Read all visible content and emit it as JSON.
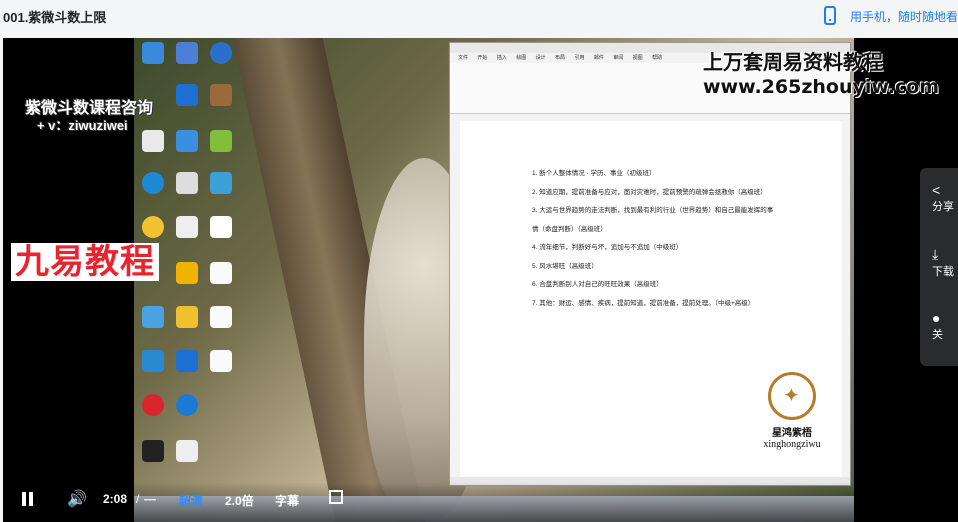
{
  "header": {
    "title": "001.紫微斗数上限",
    "phone_link": "用手机，随时随地看"
  },
  "video": {
    "overlay_course": "紫微斗数课程咨询",
    "overlay_wechat": "+ v：ziwuziwei",
    "overlay_brand": "九易教程",
    "overlay_top_right": "上万套周易资料教程",
    "overlay_url": "www.265zhouyiw.com",
    "logo_cn": "星鸿紫梧",
    "logo_en": "xinghongziwu",
    "word_doc": {
      "menu": [
        "文件",
        "开始",
        "插入",
        "绘图",
        "设计",
        "布局",
        "引用",
        "邮件",
        "审阅",
        "视图",
        "帮助"
      ],
      "items": [
        "1.  断个人整体情况 · 学历、事业（初级班）",
        "2.  知道应期，提前准备与应对，面对灾难时，提前预警的疏弹会拯救你（高级班）",
        "3.  大运与世界趋势的走法判断，找到最有利的行业（世界趋势）和自己最能发挥的事",
        "     情（命盘判断）（高级班）",
        "4.  流年细节，判断好与坏，追加与不追加（中级班）",
        "5.  风水堪旺（高级班）",
        "6.  合盘判断别人对自己的旺旺效果（高级班）",
        "7.  其他：财运、感情、疾病，提前知道，提前准备，提前处理。（中级+高级）"
      ]
    }
  },
  "side_panel": {
    "share": "分享",
    "download": "下载",
    "close": "关"
  },
  "controls": {
    "current_time": "2:08",
    "separator": "/",
    "duration": "---",
    "quality": "超清",
    "speed": "2.0倍",
    "subtitle": "字幕"
  }
}
